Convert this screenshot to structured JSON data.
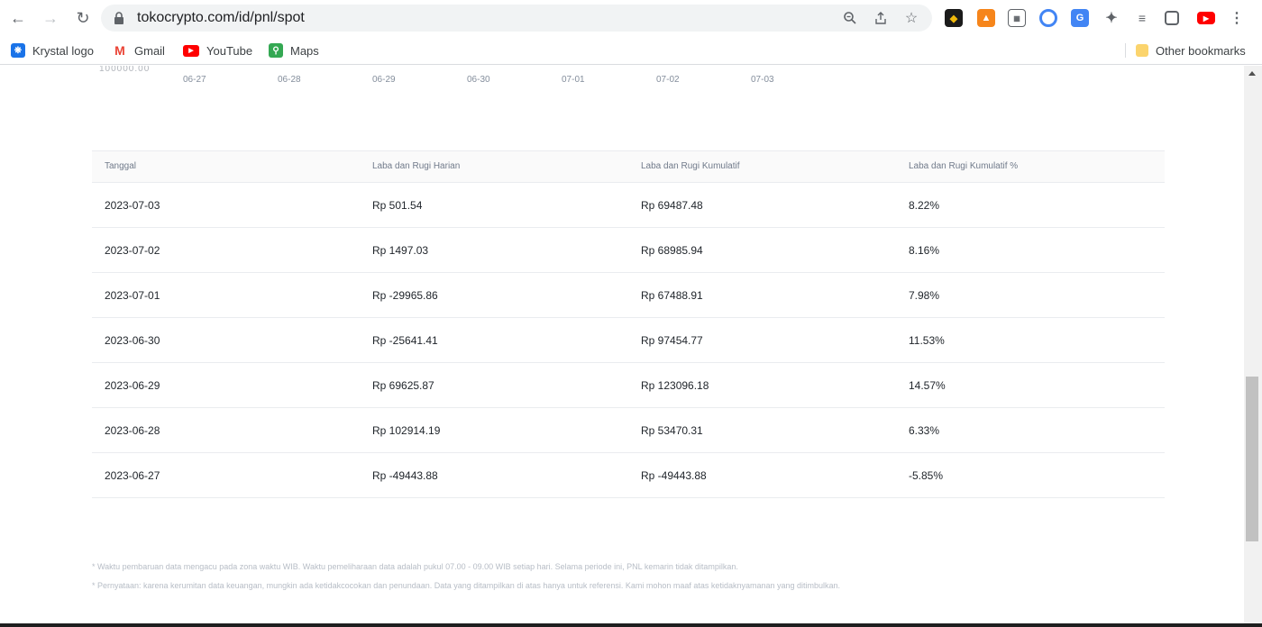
{
  "browser": {
    "url": "tokocrypto.com/id/pnl/spot",
    "bookmarks": [
      {
        "label": "Krystal logo",
        "icon": "krystal-icon"
      },
      {
        "label": "Gmail",
        "icon": "gmail-icon"
      },
      {
        "label": "YouTube",
        "icon": "youtube-icon"
      },
      {
        "label": "Maps",
        "icon": "maps-icon"
      }
    ],
    "other_bookmarks": "Other bookmarks"
  },
  "chart": {
    "axis_cut_label": "100000.00",
    "x_ticks": [
      "06-27",
      "06-28",
      "06-29",
      "06-30",
      "07-01",
      "07-02",
      "07-03"
    ]
  },
  "table": {
    "headers": [
      "Tanggal",
      "Laba dan Rugi Harian",
      "Laba dan Rugi Kumulatif",
      "Laba dan Rugi Kumulatif %"
    ],
    "rows": [
      [
        "2023-07-03",
        "Rp 501.54",
        "Rp 69487.48",
        "8.22%"
      ],
      [
        "2023-07-02",
        "Rp 1497.03",
        "Rp 68985.94",
        "8.16%"
      ],
      [
        "2023-07-01",
        "Rp -29965.86",
        "Rp 67488.91",
        "7.98%"
      ],
      [
        "2023-06-30",
        "Rp -25641.41",
        "Rp 97454.77",
        "11.53%"
      ],
      [
        "2023-06-29",
        "Rp 69625.87",
        "Rp 123096.18",
        "14.57%"
      ],
      [
        "2023-06-28",
        "Rp 102914.19",
        "Rp 53470.31",
        "6.33%"
      ],
      [
        "2023-06-27",
        "Rp -49443.88",
        "Rp -49443.88",
        "-5.85%"
      ]
    ]
  },
  "notes": [
    "* Waktu pembaruan data mengacu pada zona waktu WIB. Waktu pemeliharaan data adalah pukul 07.00 - 09.00 WIB setiap hari. Selama periode ini, PNL kemarin tidak ditampilkan.",
    "* Pernyataan: karena kerumitan data keuangan, mungkin ada ketidakcocokan dan penundaan. Data yang ditampilkan di atas hanya untuk referensi. Kami mohon maaf atas ketidaknyamanan yang ditimbulkan."
  ]
}
